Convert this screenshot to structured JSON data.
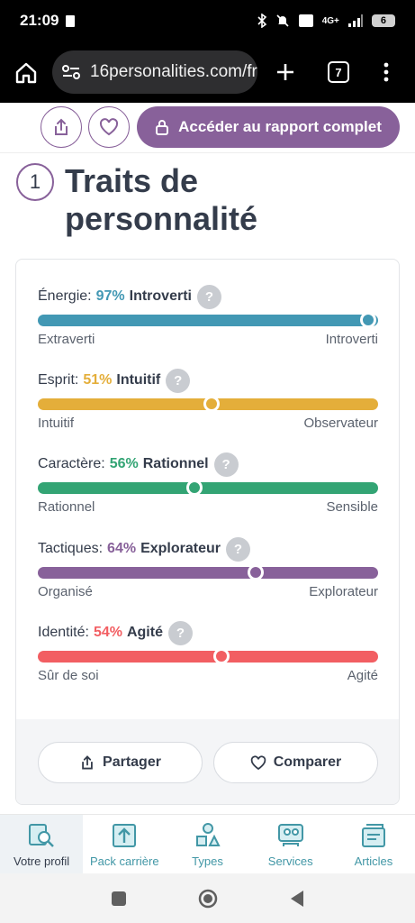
{
  "status_bar": {
    "time": "21:09",
    "network": "4G+",
    "battery": "6"
  },
  "browser": {
    "url": "16personalities.com/fr",
    "tab_count": "7"
  },
  "actions": {
    "report_label": "Accéder au rapport complet"
  },
  "section": {
    "number": "1",
    "title": "Traits de personnalité"
  },
  "traits": [
    {
      "name": "Énergie:",
      "percent": "97%",
      "dominant": "Introverti",
      "left": "Extraverti",
      "right": "Introverti",
      "value": 0.97,
      "color": "#4298b4"
    },
    {
      "name": "Esprit:",
      "percent": "51%",
      "dominant": "Intuitif",
      "left": "Intuitif",
      "right": "Observateur",
      "value": 0.51,
      "color": "#e4ae3a"
    },
    {
      "name": "Caractère:",
      "percent": "56%",
      "dominant": "Rationnel",
      "left": "Rationnel",
      "right": "Sensible",
      "value": 0.46,
      "color": "#33a474"
    },
    {
      "name": "Tactiques:",
      "percent": "64%",
      "dominant": "Explorateur",
      "left": "Organisé",
      "right": "Explorateur",
      "value": 0.64,
      "color": "#88619a"
    },
    {
      "name": "Identité:",
      "percent": "54%",
      "dominant": "Agité",
      "left": "Sûr de soi",
      "right": "Agité",
      "value": 0.54,
      "color": "#f25e62"
    }
  ],
  "card_footer": {
    "share_label": "Partager",
    "compare_label": "Comparer"
  },
  "bottom_nav": [
    {
      "label": "Votre profil",
      "icon": "search-profile-icon"
    },
    {
      "label": "Pack carrière",
      "icon": "career-icon"
    },
    {
      "label": "Types",
      "icon": "types-icon"
    },
    {
      "label": "Services",
      "icon": "services-icon"
    },
    {
      "label": "Articles",
      "icon": "articles-icon"
    }
  ]
}
